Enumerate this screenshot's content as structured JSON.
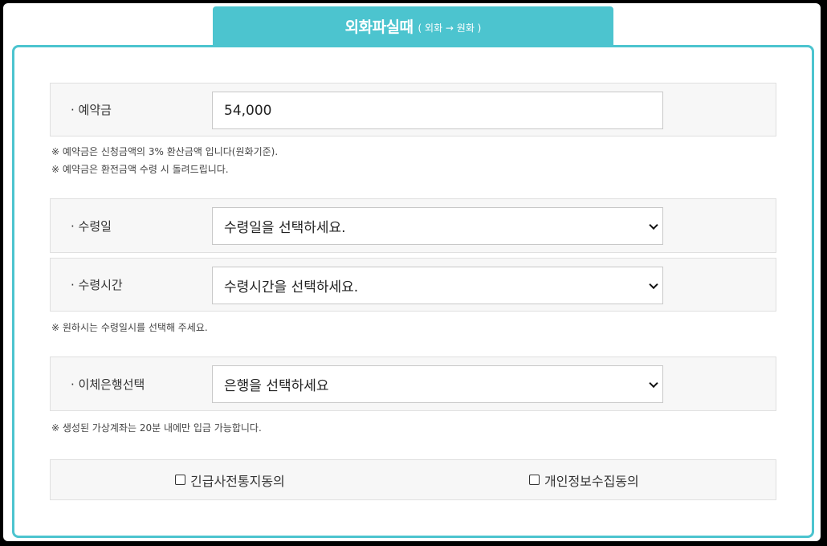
{
  "tab": {
    "title": "외화파실때",
    "subtitle": "( 외화 → 원화 )"
  },
  "deposit": {
    "label": "· 예약금",
    "value": "54,000"
  },
  "deposit_notes": [
    "※ 예약금은 신청금액의 3% 환산금액 입니다(원화기준).",
    "※ 예약금은 환전금액 수령 시 돌려드립니다."
  ],
  "pickup_date": {
    "label": "· 수령일",
    "selected": "수령일을 선택하세요."
  },
  "pickup_time": {
    "label": "· 수령시간",
    "selected": "수령시간을 선택하세요."
  },
  "pickup_note": "※ 원하시는 수령일시를 선택해 주세요.",
  "bank": {
    "label": "· 이체은행선택",
    "selected": "은행을 선택하세요"
  },
  "bank_note": "※  생성된 가상계좌는 20분 내에만 입금 가능합니다.",
  "agreements": {
    "emergency": "긴급사전통지동의",
    "privacy": "개인정보수집동의"
  },
  "colors": {
    "accent": "#4cc4cf",
    "row_bg": "#f7f7f7"
  }
}
